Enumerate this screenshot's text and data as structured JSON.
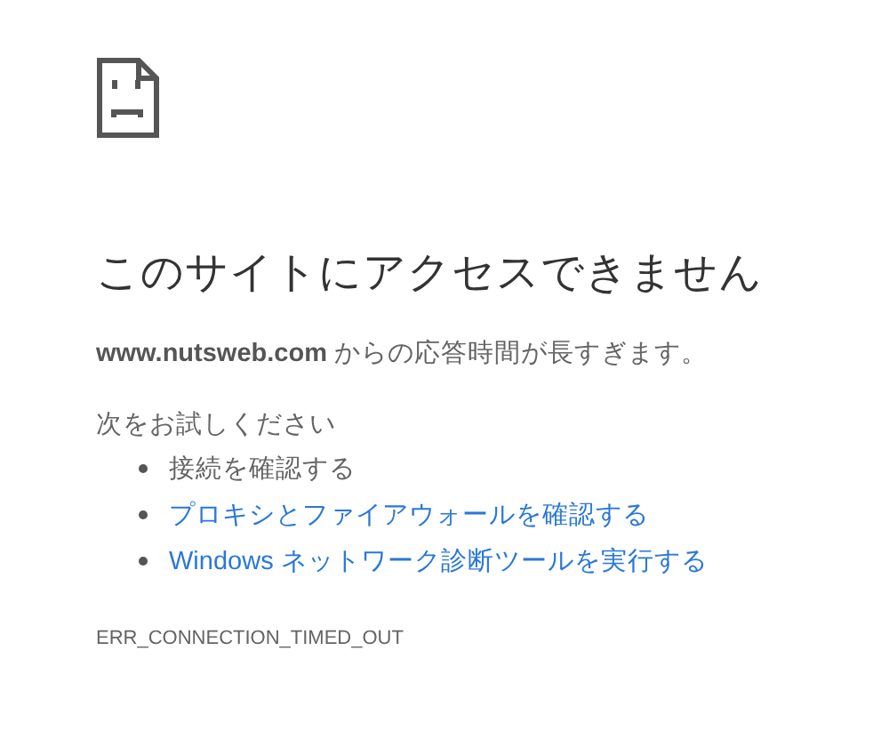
{
  "heading": "このサイトにアクセスできません",
  "description": "**www.nutsweb.com** からの応答時間が長すぎます。",
  "suggestions_title": "次をお試しください",
  "suggestions": [
    {
      "kind": "text",
      "label": "接続を確認する"
    },
    {
      "kind": "link",
      "label": "プロキシとファイアウォールを確認する"
    },
    {
      "kind": "link",
      "label": "Windows ネットワーク診断ツールを実行する"
    }
  ],
  "error_code": "ERR_CONNECTION_TIMED_OUT"
}
